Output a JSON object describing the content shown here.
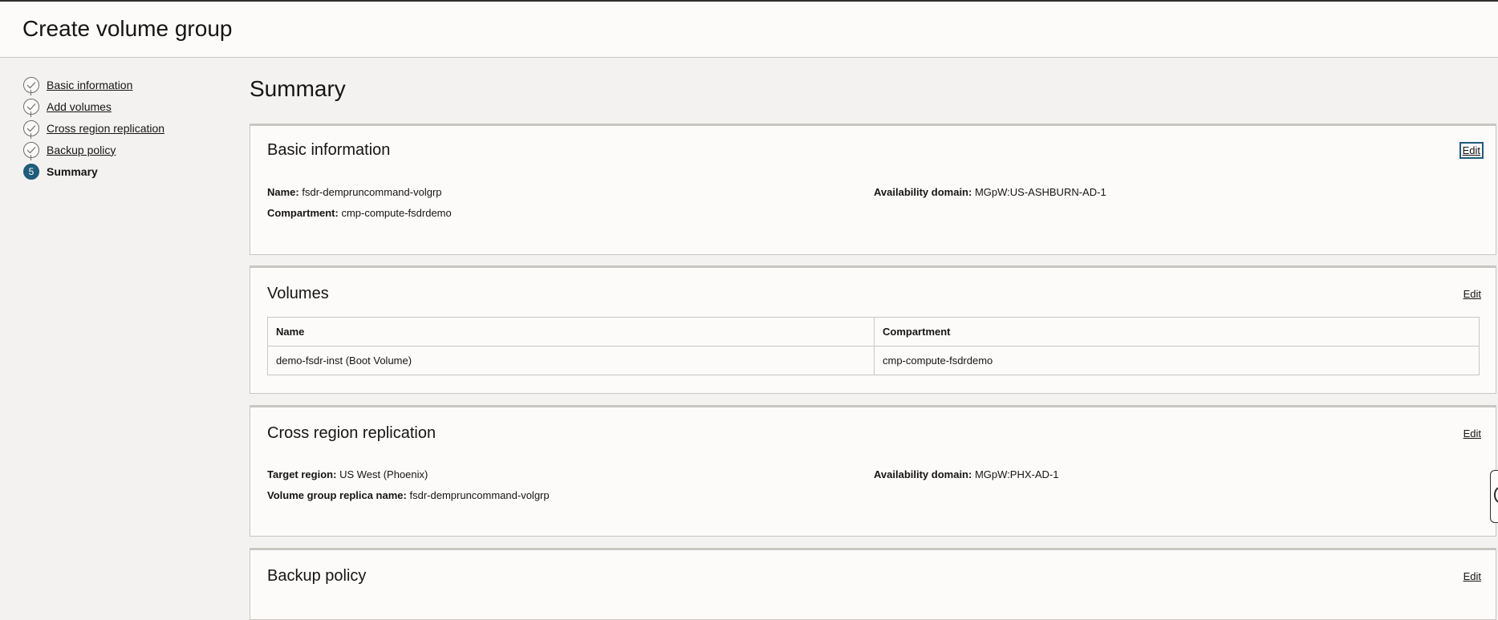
{
  "header": {
    "title": "Create volume group"
  },
  "steps": [
    {
      "number": "1",
      "label": "Basic information",
      "state": "complete"
    },
    {
      "number": "2",
      "label": "Add volumes",
      "state": "complete"
    },
    {
      "number": "3",
      "label": "Cross region replication",
      "state": "complete"
    },
    {
      "number": "4",
      "label": "Backup policy",
      "state": "complete"
    },
    {
      "number": "5",
      "label": "Summary",
      "state": "active"
    }
  ],
  "main": {
    "title": "Summary",
    "edit_label": "Edit",
    "basic": {
      "title": "Basic information",
      "name_label": "Name:",
      "name_value": "fsdr-dempruncommand-volgrp",
      "compartment_label": "Compartment:",
      "compartment_value": "cmp-compute-fsdrdemo",
      "ad_label": "Availability domain:",
      "ad_value": "MGpW:US-ASHBURN-AD-1"
    },
    "volumes": {
      "title": "Volumes",
      "columns": [
        "Name",
        "Compartment"
      ],
      "rows": [
        [
          "demo-fsdr-inst (Boot Volume)",
          "cmp-compute-fsdrdemo"
        ]
      ]
    },
    "replication": {
      "title": "Cross region replication",
      "target_label": "Target region:",
      "target_value": "US West (Phoenix)",
      "replica_label": "Volume group replica name:",
      "replica_value": "fsdr-dempruncommand-volgrp",
      "ad_label": "Availability domain:",
      "ad_value": "MGpW:PHX-AD-1"
    },
    "backup": {
      "title": "Backup policy"
    }
  },
  "colors": {
    "accent": "#1f5c7a",
    "border": "#c9c6c2",
    "background": "#f3f2f1",
    "card": "#fcfbfa"
  },
  "icons": {
    "complete_step": "check-circle-icon",
    "help_tab": "help-icon"
  }
}
